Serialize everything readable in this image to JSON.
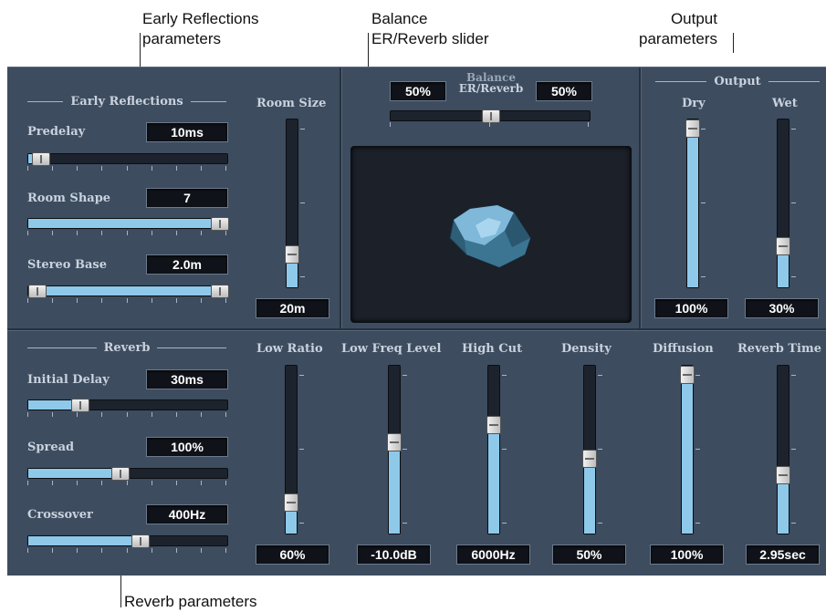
{
  "callouts": {
    "early_reflections": [
      "Early Reflections",
      "parameters"
    ],
    "balance": [
      "Balance",
      "ER/Reverb slider"
    ],
    "output": [
      "Output",
      "parameters"
    ],
    "reverb": "Reverb parameters"
  },
  "early_reflections": {
    "title": "Early Reflections",
    "predelay": {
      "label": "Predelay",
      "value": "10ms",
      "level": 0.1
    },
    "room_shape": {
      "label": "Room Shape",
      "value": "7",
      "level": 1.0
    },
    "stereo_base": {
      "label": "Stereo Base",
      "value": "2.0m",
      "range": [
        0.05,
        1.0
      ]
    },
    "room_size": {
      "label": "Room Size",
      "value": "20m",
      "level": 0.25
    }
  },
  "balance": {
    "label_line1": "Balance",
    "label_line2": "ER/Reverb",
    "left_value": "50%",
    "right_value": "50%",
    "level": 0.5
  },
  "output": {
    "title": "Output",
    "dry": {
      "label": "Dry",
      "value": "100%",
      "level": 1.0
    },
    "wet": {
      "label": "Wet",
      "value": "30%",
      "level": 0.3
    }
  },
  "reverb": {
    "title": "Reverb",
    "initial_delay": {
      "label": "Initial Delay",
      "value": "30ms",
      "level": 0.3
    },
    "spread": {
      "label": "Spread",
      "value": "100%",
      "level": 0.5
    },
    "crossover": {
      "label": "Crossover",
      "value": "400Hz",
      "level": 0.6
    }
  },
  "reverb_faders": [
    {
      "label": "Low Ratio",
      "value": "60%",
      "level": 0.24
    },
    {
      "label": "Low Freq Level",
      "value": "-10.0dB",
      "level": 0.6
    },
    {
      "label": "High Cut",
      "value": "6000Hz",
      "level": 0.7
    },
    {
      "label": "Density",
      "value": "50%",
      "level": 0.5
    },
    {
      "label": "Diffusion",
      "value": "100%",
      "level": 1.0
    },
    {
      "label": "Reverb Time",
      "value": "2.95sec",
      "level": 0.4
    }
  ],
  "colors": {
    "panel": "#3d4c5f",
    "fill": "#8ec9ea",
    "display": "#1b2029",
    "room": "#7fb8d8"
  }
}
